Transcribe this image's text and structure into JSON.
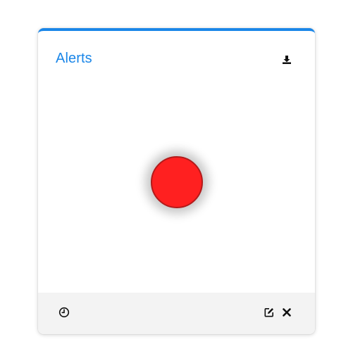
{
  "widget": {
    "title": "Alerts",
    "accent_color": "#1a86e8",
    "status": {
      "color": "#ff2020",
      "state": "red"
    }
  },
  "header": {
    "download_icon": "download-icon"
  },
  "footer": {
    "left_icons": [
      "clock-icon"
    ],
    "right_icons": [
      "edit-icon",
      "close-icon"
    ]
  }
}
